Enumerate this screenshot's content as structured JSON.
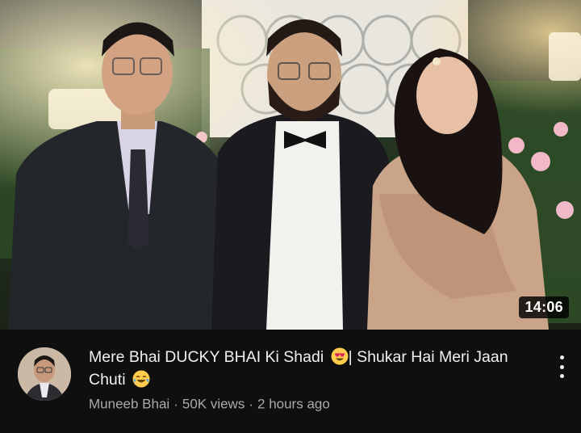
{
  "video": {
    "duration": "14:06",
    "title_part1": "Mere Bhai DUCKY BHAI Ki Shadi ",
    "title_emoji1": "heart-eyes-emoji",
    "title_part2": "| Shukar Hai Meri Jaan Chuti ",
    "title_emoji2": "tears-of-joy-emoji",
    "channel": "Muneeb Bhai",
    "views": "50K views",
    "age": "2 hours ago",
    "separator": "·"
  },
  "icons": {
    "more": "more-vertical-icon",
    "avatar": "channel-avatar"
  },
  "colors": {
    "background": "#0f0f0f",
    "title": "#f1f1f1",
    "secondary": "#aaaaaa",
    "duration_bg": "#000000"
  }
}
